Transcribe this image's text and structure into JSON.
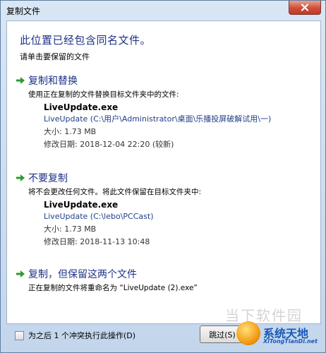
{
  "window": {
    "title": "复制文件"
  },
  "dialog": {
    "heading": "此位置已经包含同名文件。",
    "subheading": "请单击要保留的文件"
  },
  "options": [
    {
      "title": "复制和替换",
      "desc": "使用正在复制的文件替换目标文件夹中的文件:",
      "file": {
        "name": "LiveUpdate.exe",
        "path": "LiveUpdate (C:\\用户\\Administrator\\桌面\\乐播投屏破解试用\\一)",
        "size": "大小: 1.73 MB",
        "modified": "修改日期: 2018-12-04 22:20 (较新)"
      }
    },
    {
      "title": "不要复制",
      "desc": "将不会更改任何文件。将此文件保留在目标文件夹中:",
      "file": {
        "name": "LiveUpdate.exe",
        "path": "LiveUpdate (C:\\lebo\\PCCast)",
        "size": "大小: 1.73 MB",
        "modified": "修改日期: 2018-11-13 10:48"
      }
    },
    {
      "title": "复制，但保留这两个文件",
      "desc": "正在复制的文件将重命名为 “LiveUpdate (2).exe”"
    }
  ],
  "footer": {
    "checkbox_label": "为之后 1 个冲突执行此操作(D)",
    "skip_label": "跳过(S)"
  },
  "watermark": {
    "faded": "当下软件园",
    "brand": "系统天地",
    "url": "XiTongTianDi.net"
  },
  "colors": {
    "heading": "#1e3287",
    "arrow": "#2e9a2e",
    "close": "#c0392b"
  },
  "icons": {
    "close": "close-icon",
    "arrow": "green-arrow-icon"
  }
}
